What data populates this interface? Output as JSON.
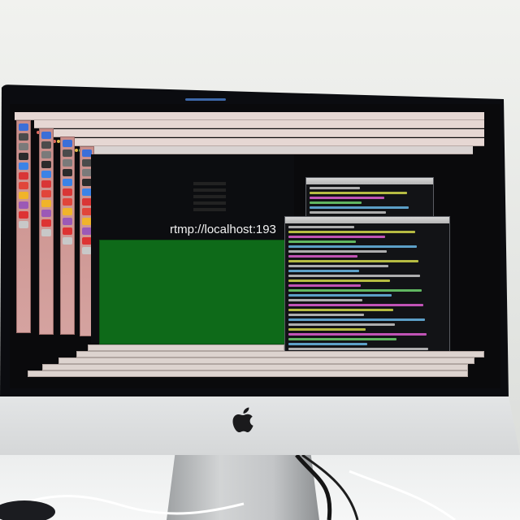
{
  "scene": {
    "overlay_text": "rtmp://localhost:193",
    "colors": {
      "stream_panel": "#0e6a19",
      "bezel": "#0b0c10",
      "window_chrome": "#e6d7d3",
      "dock": "#c98e8a",
      "terminal_bg": "#121316",
      "apple_logo": "#1a1a1c"
    },
    "icons": [
      "apple-logo-icon",
      "dock-app-icons",
      "window-control-dots"
    ],
    "dock_icon_colors": [
      "#3b6fd8",
      "#4b4b4b",
      "#7a7a7a",
      "#2b2b2b",
      "#3c83e6",
      "#d93636",
      "#e1453a",
      "#f0b42a",
      "#9b59b6",
      "#d33",
      "#c8c8c8"
    ],
    "terminal_line_colors": [
      "#c9c9c9",
      "#d4d94a",
      "#e05fd2",
      "#6fd36f",
      "#6ab8e6",
      "#c9c9c9",
      "#e05fd2",
      "#d4d94a",
      "#c9c9c9",
      "#6ab8e6"
    ]
  }
}
